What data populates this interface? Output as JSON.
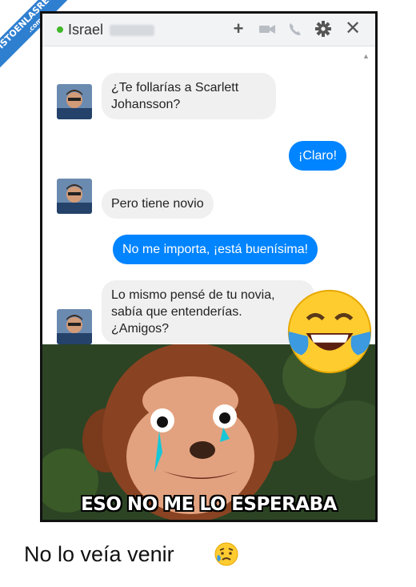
{
  "watermark": {
    "site": "VISTOENLASREDES",
    "domain": ".com",
    "color": "#2f7fd0"
  },
  "chat": {
    "contact_name": "Israel",
    "status_color": "#42b72a",
    "toolbar_icons": [
      "plus-icon",
      "video-camera-icon",
      "phone-icon",
      "gear-icon",
      "close-icon"
    ],
    "messages": [
      {
        "from": "them",
        "text": "¿Te follarías a Scarlett\nJohansson?"
      },
      {
        "from": "me",
        "text": "¡Claro!"
      },
      {
        "from": "them",
        "text": "Pero tiene novio"
      },
      {
        "from": "me",
        "text": "No me importa, ¡está buenísima!"
      },
      {
        "from": "them",
        "text": "Lo mismo pensé de tu novia,\nsabía que entenderías.\n¿Amigos?"
      }
    ],
    "sent_bubble_color": "#0084ff",
    "received_bubble_color": "#f1f0f0"
  },
  "meme": {
    "caption": "ESO NO ME LO ESPERABA",
    "overlay_emoji": "face-with-tears-of-joy"
  },
  "footer": {
    "text": "No lo veía venir",
    "emoji": "disappointed-relieved-face"
  }
}
